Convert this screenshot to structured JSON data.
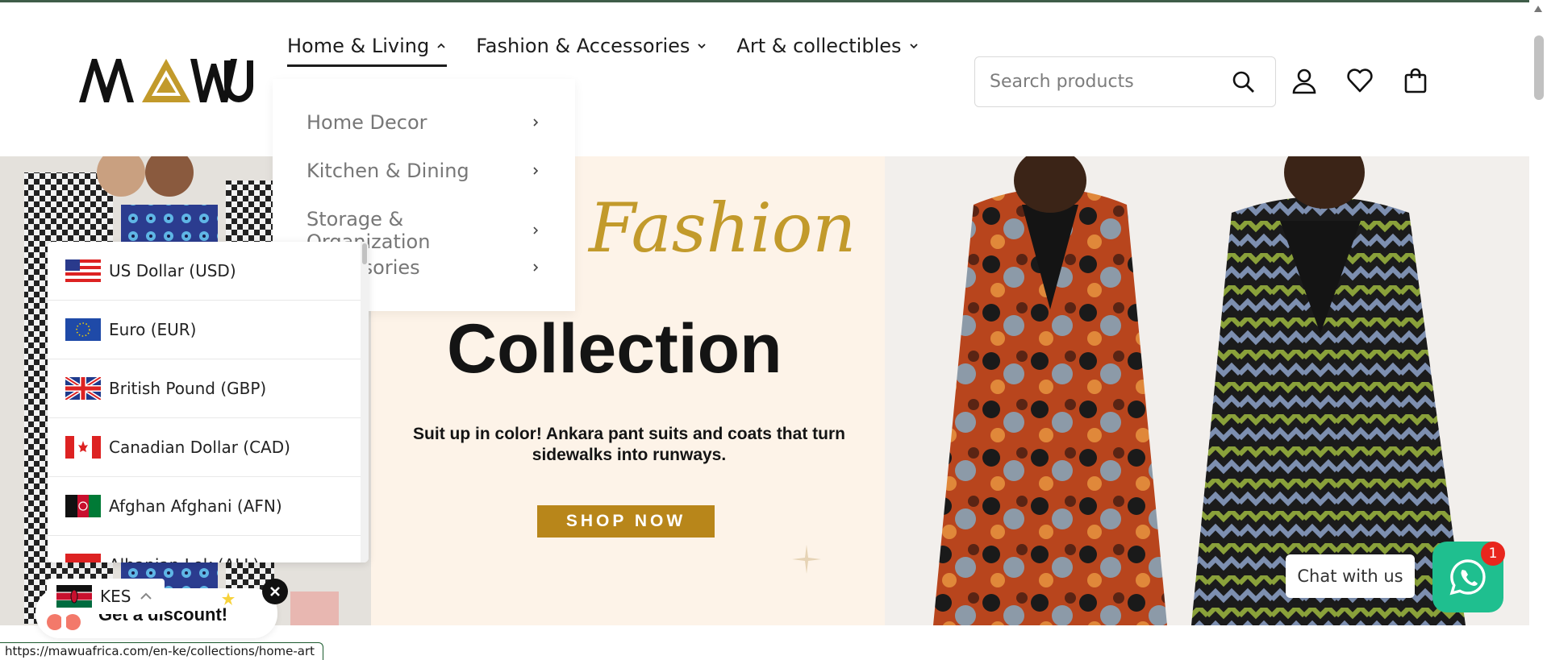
{
  "brand": {
    "logo_text": "MAWU"
  },
  "nav": {
    "items": [
      {
        "label": "Home & Living",
        "state": "expanded"
      },
      {
        "label": "Fashion & Accessories",
        "state": "collapsed"
      },
      {
        "label": "Art & collectibles",
        "state": "collapsed"
      }
    ]
  },
  "search": {
    "placeholder": "Search products"
  },
  "header_icons": [
    "account-icon",
    "wishlist-heart-icon",
    "cart-bag-icon"
  ],
  "home_living_menu": {
    "items": [
      {
        "label": "Home Decor"
      },
      {
        "label": "Kitchen & Dining"
      },
      {
        "label": "Storage & Organization"
      },
      {
        "label": "Accessories"
      }
    ]
  },
  "hero": {
    "script_word": "Fashion",
    "headline": "Collection",
    "tagline": "Suit up in color! Ankara pant suits and coats that turn sidewalks into runways.",
    "cta": "SHOP NOW"
  },
  "currency_selector": {
    "selected": "KES",
    "options": [
      {
        "label": "US Dollar (USD)",
        "flag": "us-flag"
      },
      {
        "label": "Euro (EUR)",
        "flag": "eu-flag"
      },
      {
        "label": "British Pound (GBP)",
        "flag": "uk-flag"
      },
      {
        "label": "Canadian Dollar (CAD)",
        "flag": "ca-flag"
      },
      {
        "label": "Afghan Afghani (AFN)",
        "flag": "af-flag"
      },
      {
        "label": "Albanian Lek (ALL)",
        "flag": "al-flag"
      }
    ]
  },
  "discount_popup": {
    "label": "Get a discount!"
  },
  "chat": {
    "label": "Chat with us",
    "badge": "1"
  },
  "status_bar": {
    "url": "https://mawuafrica.com/en-ke/collections/home-art"
  },
  "colors": {
    "accent_gold": "#b8861a",
    "whatsapp_green": "#1fbf8f",
    "badge_red": "#e8261d"
  }
}
